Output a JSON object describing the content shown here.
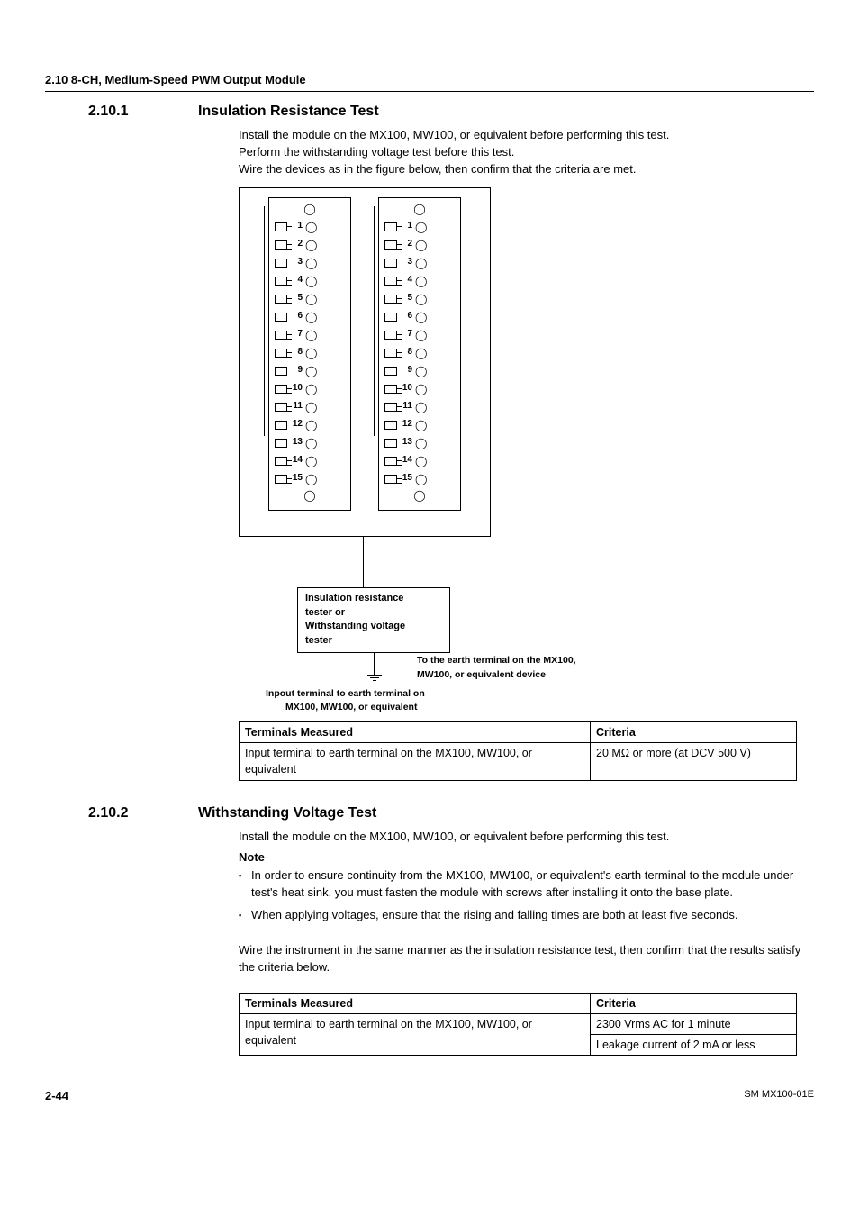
{
  "section_header": "2.10  8-CH, Medium-Speed PWM Output Module",
  "s1": {
    "num": "2.10.1",
    "title": "Insulation Resistance Test",
    "p1": "Install the module on the MX100, MW100, or equivalent before performing this test.",
    "p2": "Perform the withstanding voltage test before this test.",
    "p3": "Wire the devices as in the figure below, then confirm that the criteria are met."
  },
  "figure": {
    "tester_l1": "Insulation resistance",
    "tester_l2": "tester or",
    "tester_l3": "Withstanding voltage",
    "tester_l4": "tester",
    "cap_earth_l1": "To the earth terminal on the MX100,",
    "cap_earth_l2": "MW100, or equivalent device",
    "cap_bottom_l1": "Inpout terminal to earth terminal on",
    "cap_bottom_l2": "MX100, MW100, or equivalent",
    "terminal_nums": [
      "1",
      "2",
      "3",
      "4",
      "5",
      "6",
      "7",
      "8",
      "9",
      "10",
      "11",
      "12",
      "13",
      "14",
      "15"
    ],
    "wired_rows": [
      1,
      2,
      4,
      5,
      7,
      8,
      10,
      11,
      14,
      15
    ]
  },
  "table1": {
    "h1": "Terminals Measured",
    "h2": "Criteria",
    "r1c1": "Input terminal to earth terminal on the MX100, MW100, or equivalent",
    "r1c2": "20 MΩ or more  (at DCV 500 V)"
  },
  "s2": {
    "num": "2.10.2",
    "title": "Withstanding Voltage Test",
    "p1": "Install the module on the MX100, MW100, or equivalent before performing this test.",
    "note_head": "Note",
    "n1": "In order to ensure continuity from the MX100, MW100, or equivalent's earth terminal to the module under test's heat sink, you must fasten the module with screws after installing it onto the base plate.",
    "n2": "When applying voltages, ensure that the rising and falling times are both at least five seconds.",
    "p2": "Wire the instrument in the same manner as the insulation resistance test, then confirm that the results satisfy the criteria below."
  },
  "table2": {
    "h1": "Terminals Measured",
    "h2": "Criteria",
    "r1c1": "Input terminal to earth terminal on the MX100, MW100, or equivalent",
    "r1c2a": "2300 Vrms AC for 1 minute",
    "r1c2b": "Leakage current of 2 mA or less"
  },
  "footer": {
    "page": "2-44",
    "doc": "SM MX100-01E"
  }
}
